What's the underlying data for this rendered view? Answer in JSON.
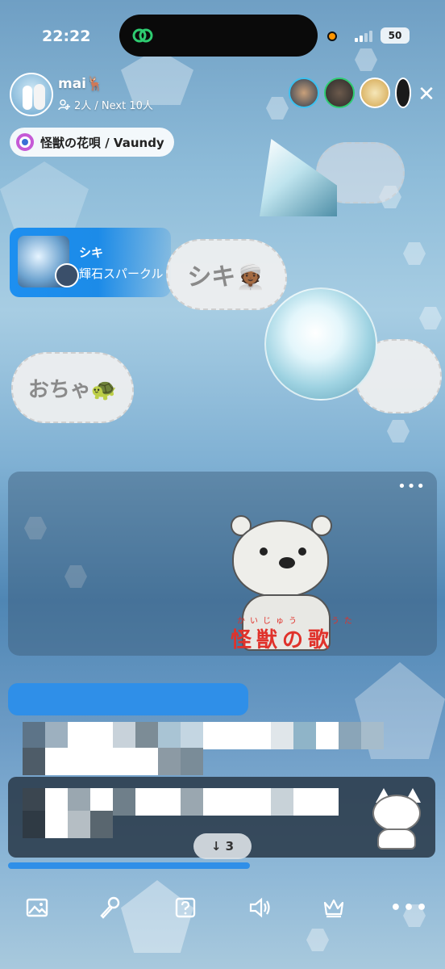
{
  "status_bar": {
    "time": "22:22",
    "battery": "50"
  },
  "room": {
    "host_name": "mai🦌",
    "listener_info": "2人 / Next 10人",
    "song_chip": "怪獣の花唄 / Vaundy",
    "close_symbol": "✕"
  },
  "now_playing": {
    "user": "シキ",
    "title": "輝石スパークル"
  },
  "clouds": {
    "c1": "シキ👳🏾",
    "c2": "おちゃ🐢"
  },
  "media": {
    "more": "•••",
    "ruby_1": "かいじゅう",
    "ruby_2": "うた",
    "title": "怪獣の歌"
  },
  "chat": {
    "scroll_count": "↓ 3"
  },
  "toolbar": {
    "more": "•••"
  },
  "colors": {
    "accent_blue": "#2f8fe8",
    "ring": "#3cc1f0",
    "red_title": "#e0322b"
  }
}
